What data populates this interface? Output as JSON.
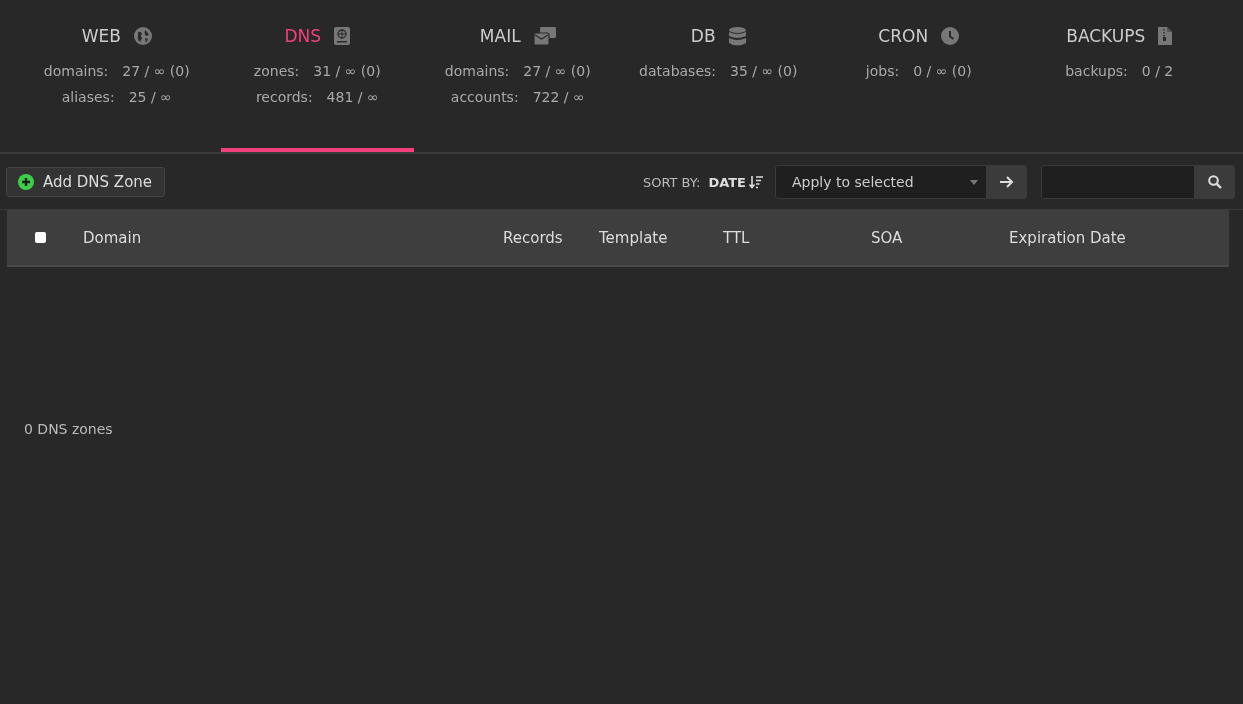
{
  "tabs": [
    {
      "title": "WEB",
      "kind": "globe",
      "selected": false,
      "stats": [
        {
          "label": "domains:",
          "value": "27 / ∞ (0)"
        },
        {
          "label": "aliases:",
          "value": "25 / ∞"
        }
      ]
    },
    {
      "title": "DNS",
      "kind": "book",
      "selected": true,
      "stats": [
        {
          "label": "zones:",
          "value": "31 / ∞ (0)"
        },
        {
          "label": "records:",
          "value": "481 / ∞"
        }
      ]
    },
    {
      "title": "MAIL",
      "kind": "mail",
      "selected": false,
      "stats": [
        {
          "label": "domains:",
          "value": "27 / ∞ (0)"
        },
        {
          "label": "accounts:",
          "value": "722 / ∞"
        }
      ]
    },
    {
      "title": "DB",
      "kind": "database",
      "selected": false,
      "stats": [
        {
          "label": "databases:",
          "value": "35 / ∞ (0)"
        }
      ]
    },
    {
      "title": "CRON",
      "kind": "clock",
      "selected": false,
      "stats": [
        {
          "label": "jobs:",
          "value": "0 / ∞ (0)"
        }
      ]
    },
    {
      "title": "BACKUPS",
      "kind": "file",
      "selected": false,
      "stats": [
        {
          "label": "backups:",
          "value": "0 / 2"
        }
      ]
    }
  ],
  "toolbar": {
    "add_button": "Add DNS Zone",
    "sort_label": "SORT BY:",
    "sort_value": "DATE",
    "bulk_select": "Apply to selected"
  },
  "table": {
    "select_all_checked": false,
    "columns": [
      "Domain",
      "Records",
      "Template",
      "TTL",
      "SOA",
      "Expiration Date"
    ]
  },
  "footer": "0 DNS zones"
}
